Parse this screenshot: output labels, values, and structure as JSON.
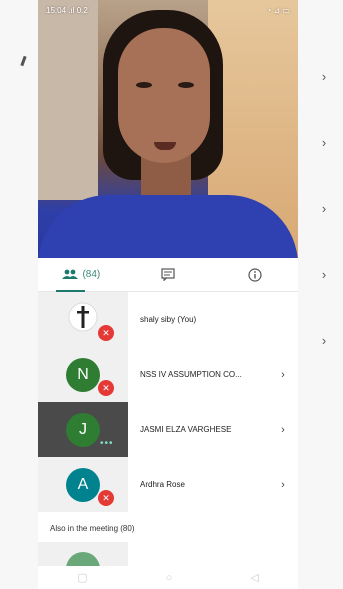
{
  "status_bar": {
    "time": "15:04",
    "left_info": "15:04 .ıl 0.2",
    "right_info": "◔ ⊿ ▭"
  },
  "tabs": [
    {
      "icon": "people-icon",
      "label": "(84)"
    },
    {
      "icon": "chat-icon",
      "label": ""
    },
    {
      "icon": "info-icon",
      "label": ""
    }
  ],
  "participants": [
    {
      "name": "shaly siby (You)",
      "avatar_letter": "",
      "avatar_color": "#ffffff",
      "muted": true,
      "chevron": ""
    },
    {
      "name": "NSS IV ASSUMPTION CO...",
      "avatar_letter": "N",
      "avatar_color": "#2e7d32",
      "muted": true,
      "chevron": "›"
    },
    {
      "name": "JASMI ELZA VARGHESE",
      "avatar_letter": "J",
      "avatar_color": "#2e7d32",
      "muted": false,
      "chevron": "›"
    },
    {
      "name": "Ardhra Rose",
      "avatar_letter": "A",
      "avatar_color": "#00838f",
      "muted": true,
      "chevron": "›"
    }
  ],
  "also_in_meeting": "Also in the meeting (80)",
  "background_chevron": "›",
  "colors": {
    "accent": "#1e7a6c",
    "mute_red": "#e53935"
  }
}
